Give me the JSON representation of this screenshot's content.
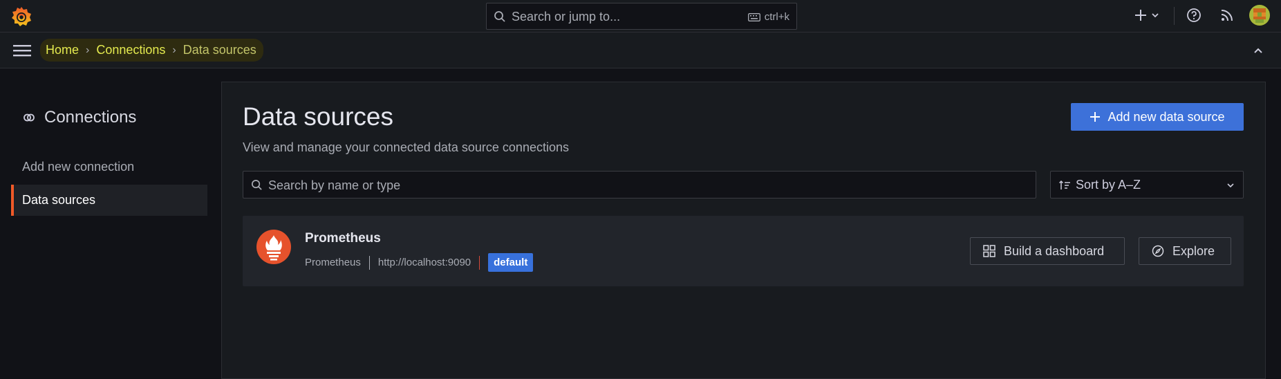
{
  "topbar": {
    "search_placeholder": "Search or jump to...",
    "shortcut": "ctrl+k",
    "icons": [
      "grafana-logo",
      "search-icon",
      "keyboard-icon",
      "plus-icon",
      "chevron-down-icon",
      "help-icon",
      "news-rss-icon",
      "user-avatar"
    ]
  },
  "breadcrumb": {
    "items": [
      "Home",
      "Connections",
      "Data sources"
    ],
    "separator": "›"
  },
  "sidebar": {
    "title": "Connections",
    "items": [
      {
        "label": "Add new connection",
        "active": false
      },
      {
        "label": "Data sources",
        "active": true
      }
    ]
  },
  "main": {
    "title": "Data sources",
    "subtitle": "View and manage your connected data source connections",
    "add_button": "Add new data source",
    "search_placeholder": "Search by name or type",
    "sort_value": "Sort by A–Z"
  },
  "datasources": [
    {
      "name": "Prometheus",
      "type": "Prometheus",
      "url": "http://localhost:9090",
      "badge": "default",
      "actions": [
        "Build a dashboard",
        "Explore"
      ]
    }
  ],
  "colors": {
    "accent_blue": "#3d71d9",
    "active_indicator": "#f05a28",
    "breadcrumb_highlight": "#e4ea4f",
    "prometheus_brand": "#e6522c"
  }
}
